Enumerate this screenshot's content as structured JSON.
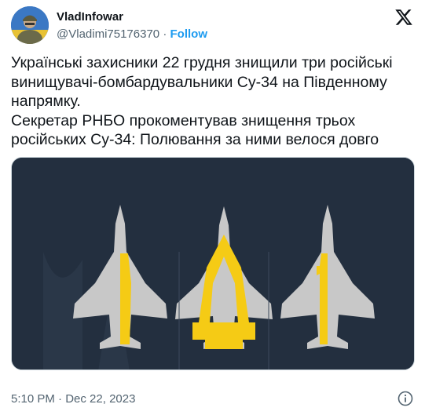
{
  "author": {
    "display_name": "VladInfowar",
    "handle": "@Vladimi75176370",
    "separator": "·",
    "follow_label": "Follow",
    "avatar_icon": "soldier-avatar",
    "brand_icon": "x-logo-icon"
  },
  "tweet": {
    "lines": [
      "Українські захисники 22 грудня знищили три російські",
      "винищувачі-бомбардувальники Су-34 на Південному",
      "напрямку.",
      "Секретар РНБО прокоментував знищення трьох",
      "російських Су-34: Полювання за ними велося довго"
    ]
  },
  "media": {
    "description_icon": "three-su34-jets-trident-illustration",
    "colors": {
      "background": "#232f3f",
      "jet": "#c8c8c8",
      "accent": "#f5cb15"
    }
  },
  "footer": {
    "time": "5:10 PM",
    "separator": "·",
    "date": "Dec 22, 2023",
    "info_icon": "info-icon"
  }
}
